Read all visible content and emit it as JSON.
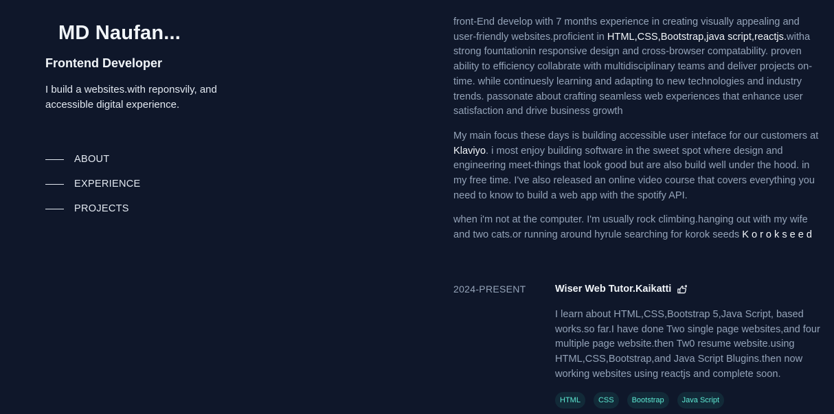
{
  "profile": {
    "name": "MD Naufan...",
    "role": "Frontend Developer",
    "tagline": "I build a websites.with reponsvily, and accessible digital experience."
  },
  "nav": {
    "items": [
      {
        "label": "ABOUT"
      },
      {
        "label": "EXPERIENCE"
      },
      {
        "label": "PROJECTS"
      }
    ]
  },
  "about": {
    "p1": {
      "line1": "front-End develop with 7 months experience in creating visually appealing and",
      "line2_a": "user-friendly websites.proficient in ",
      "line2_b": "HTML,CSS,Bootstrap,java script,reactjs.",
      "line2_c": "witha",
      "line3": "strong fountationin responsive design and cross-browser compatability. proven",
      "line4": "ability to efficiency collabrate with multidisciplinary teams and deliver projects on-",
      "line5": "time. while continuesly learning and adapting to new technologies and industry",
      "line6": "trends. passonate about crafting seamless web experiences that enhance user",
      "line7": "satisfaction and drive business growth"
    },
    "p2": {
      "line1": "My main focus these days is building accessible user inteface for our customers at",
      "line2_a": "Klaviyo",
      "line2_b": ". i most enjoy building software in the sweet spot where design and",
      "line3": "engineering meet-things that look good but are also build well under the hood. in",
      "line4": "my free time. I've also released an online video course that covers everything you",
      "line5": "need to know to build a web app with the spotify API."
    },
    "p3": {
      "line1": "when i'm not at the computer. I'm usually rock climbing.hanging out with my wife",
      "line2_a": "and two cats.or running around hyrule searching for korok seeds ",
      "line2_b": "Korokseed"
    }
  },
  "experience": {
    "date": "2024-PRESENT",
    "title": "Wiser Web Tutor.Kaikatti",
    "icon": "external-link-hand-icon",
    "desc": {
      "line1": "I learn about HTML,CSS,Bootstrap 5,Java Script, based",
      "line2": "works.so far.I have done Two single page websites,and four",
      "line3": "multiple page website.then Tw0 resume website.using",
      "line4": "HTML,CSS,Bootstrap,and Java Script Blugins.then now",
      "line5": "working websites using reactjs and complete soon."
    },
    "tags": [
      "HTML",
      "CSS",
      "Bootstrap",
      "Java Script"
    ]
  },
  "colors": {
    "background": "#0f172a",
    "heading": "#f1f5f9",
    "body": "#94a3b8",
    "tag_text": "#5eead4"
  }
}
